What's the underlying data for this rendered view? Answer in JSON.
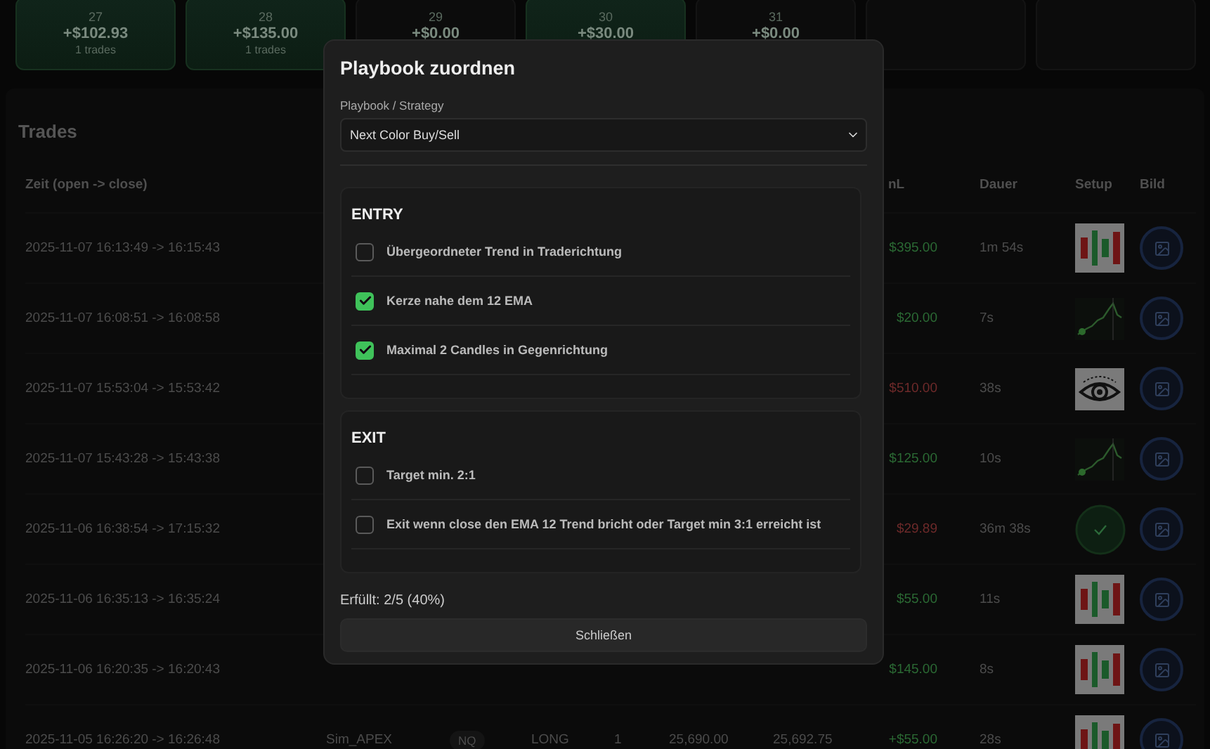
{
  "calendar": [
    {
      "day": "27",
      "amount": "+$102.93",
      "trades": "1 trades",
      "positive": true
    },
    {
      "day": "28",
      "amount": "+$135.00",
      "trades": "1 trades",
      "positive": true
    },
    {
      "day": "29",
      "amount": "+$0.00",
      "positive": false
    },
    {
      "day": "30",
      "amount": "+$30.00",
      "positive": true
    },
    {
      "day": "31",
      "amount": "+$0.00",
      "positive": false
    },
    {
      "positive": false
    },
    {
      "positive": false
    }
  ],
  "trades": {
    "title": "Trades",
    "columns": [
      "Zeit (open -> close)",
      "nL",
      "Dauer",
      "Setup",
      "Bild"
    ],
    "rows": [
      {
        "time": "2025-11-07 16:13:49 -> 16:15:43",
        "pnl": "$395.00",
        "profit": true,
        "duration": "1m 54s",
        "kind": "candles"
      },
      {
        "time": "2025-11-07 16:08:51 -> 16:08:58",
        "pnl": "$20.00",
        "profit": true,
        "duration": "7s",
        "kind": "chart"
      },
      {
        "time": "2025-11-07 15:53:04 -> 15:53:42",
        "pnl": "$510.00",
        "profit": false,
        "duration": "38s",
        "kind": "eye"
      },
      {
        "time": "2025-11-07 15:43:28 -> 15:43:38",
        "pnl": "$125.00",
        "profit": true,
        "duration": "10s",
        "kind": "chart"
      },
      {
        "time": "2025-11-06 16:38:54 -> 17:15:32",
        "pnl": "$29.89",
        "profit": false,
        "duration": "36m 38s",
        "kind": "check"
      },
      {
        "time": "2025-11-06 16:35:13 -> 16:35:24",
        "pnl": "$55.00",
        "profit": true,
        "duration": "11s",
        "kind": "candles"
      },
      {
        "time": "2025-11-06 16:20:35 -> 16:20:43",
        "pnl": "$145.00",
        "profit": true,
        "duration": "8s",
        "kind": "candles"
      },
      {
        "time": "2025-11-05 16:26:20 -> 16:26:48",
        "account": "Sim_APEX",
        "symbol": "NQ",
        "side": "LONG",
        "qty": "1",
        "entry": "25,690.00",
        "exit": "25,692.75",
        "pnl": "+$55.00",
        "profit": true,
        "duration": "28s",
        "kind": "candles"
      }
    ]
  },
  "modal": {
    "title": "Playbook zuordnen",
    "field_label": "Playbook / Strategy",
    "select_value": "Next Color Buy/Sell",
    "sections": [
      {
        "title": "ENTRY",
        "items": [
          {
            "label": "Übergeordneter Trend in Traderichtung",
            "checked": false
          },
          {
            "label": "Kerze nahe dem 12 EMA",
            "checked": true
          },
          {
            "label": "Maximal 2 Candles in Gegenrichtung",
            "checked": true
          }
        ]
      },
      {
        "title": "EXIT",
        "items": [
          {
            "label": "Target min. 2:1",
            "checked": false
          },
          {
            "label": "Exit wenn close den EMA 12 Trend bricht oder Target min 3:1 erreicht ist",
            "checked": false
          }
        ]
      }
    ],
    "summary": "Erfüllt: 2/5 (40%)",
    "close_button": "Schließen"
  }
}
